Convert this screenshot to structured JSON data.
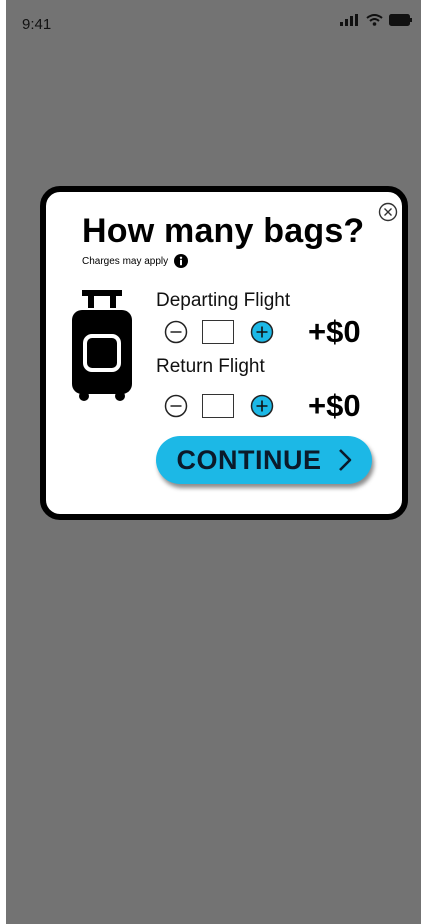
{
  "status_bar": {
    "time": "9:41",
    "icons": [
      "signal-icon",
      "wifi-icon",
      "battery-icon"
    ]
  },
  "modal": {
    "title": "How many bags?",
    "subtitle": "Charges may apply",
    "close_icon": "close-icon",
    "info_icon": "info-icon",
    "luggage_icon": "luggage-icon",
    "flights": [
      {
        "label": "Departing Flight",
        "quantity": "",
        "price": "+$0"
      },
      {
        "label": "Return Flight",
        "quantity": "",
        "price": "+$0"
      }
    ],
    "continue_label": "CONTINUE",
    "colors": {
      "accent": "#1cb8e6",
      "plus_button": "#1cb8e6",
      "overlay": "#737373"
    }
  }
}
